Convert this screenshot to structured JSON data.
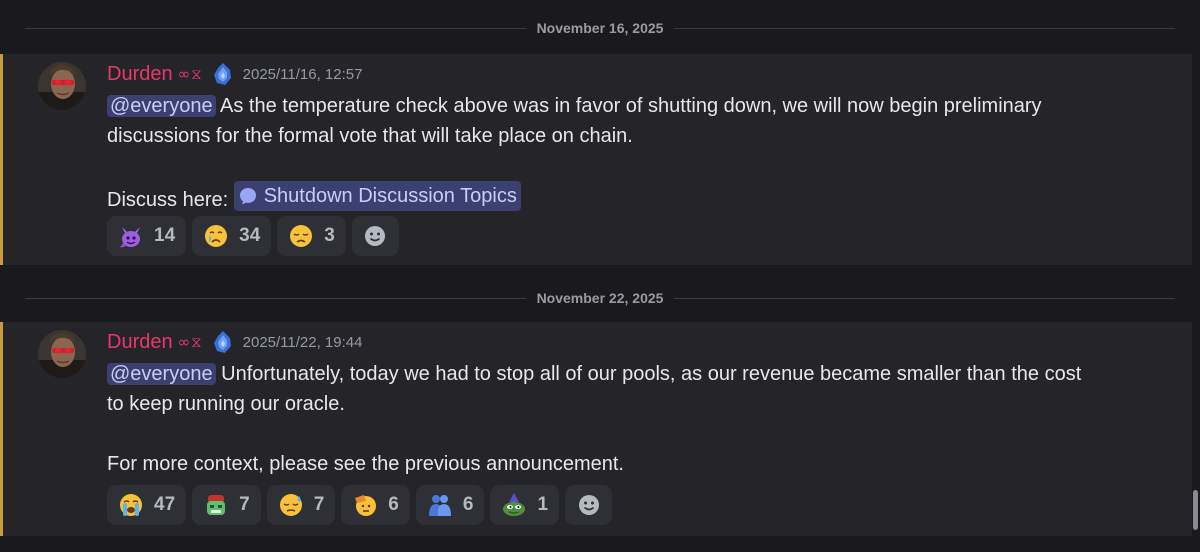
{
  "messages": [
    {
      "date_divider": "November 16, 2025",
      "author": "Durden",
      "author_badge": "∞⧖",
      "timestamp": "2025/11/16, 12:57",
      "mention": "@everyone",
      "text_line1": " As the temperature check above was in favor of shutting down, we will now begin preliminary",
      "text_line2": "discussions for the formal vote that will take place on chain.",
      "text_line3_prefix": "Discuss here: ",
      "channel_link": "Shutdown Discussion Topics",
      "reactions": [
        {
          "icon": "purple-devil-emoji-icon",
          "count": "14"
        },
        {
          "icon": "crying-face-icon",
          "count": "34"
        },
        {
          "icon": "disappointed-face-icon",
          "count": "3"
        }
      ]
    },
    {
      "date_divider": "November 22, 2025",
      "author": "Durden",
      "author_badge": "∞⧖",
      "timestamp": "2025/11/22, 19:44",
      "mention": "@everyone",
      "text_line1": " Unfortunately, today we had to stop all of our pools, as our revenue became smaller than the cost",
      "text_line2": "to keep running our oracle.",
      "text_line3": "For more context, please see the previous announcement.",
      "reactions": [
        {
          "icon": "loudly-crying-face-icon",
          "count": "47"
        },
        {
          "icon": "zombie-emoji-icon",
          "count": "7"
        },
        {
          "icon": "sad-relieved-face-icon",
          "count": "7"
        },
        {
          "icon": "saluting-face-icon",
          "count": "6"
        },
        {
          "icon": "people-hugging-icon",
          "count": "6"
        },
        {
          "icon": "pepe-wizard-emoji-icon",
          "count": "1"
        }
      ]
    }
  ],
  "colors": {
    "username": "#e8386b",
    "highlight_border": "#c89b3c",
    "mention_bg": "#3c4070"
  }
}
